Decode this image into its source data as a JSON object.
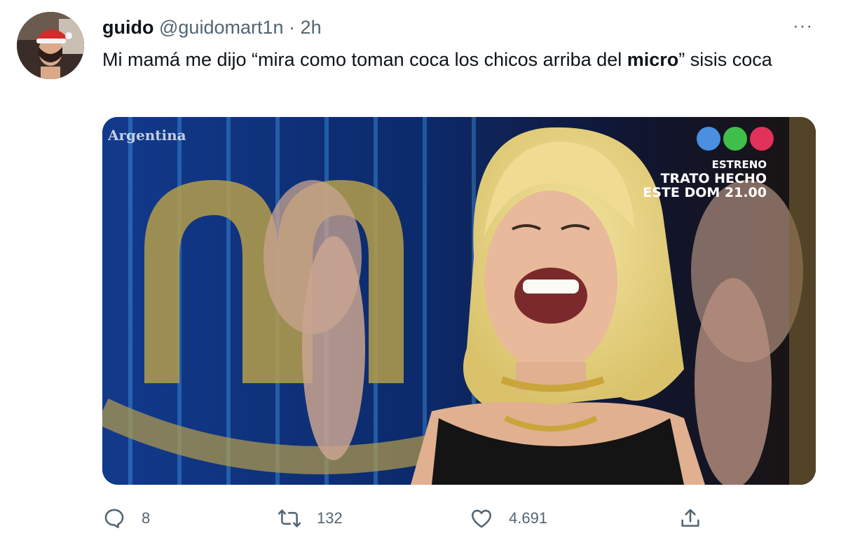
{
  "author": {
    "display_name": "guido",
    "handle": "@guidomart1n",
    "separator": "·",
    "time": "2h"
  },
  "more_label": "···",
  "tweet": {
    "text_before": "Mi mamá me dijo “mira como toman coca los chicos arriba del ",
    "text_bold": "micro",
    "text_after": "” sisis coca"
  },
  "media": {
    "corner_caption": "Argentina",
    "tv_promo": {
      "line1": "ESTRENO",
      "line2": "TRATO HECHO",
      "line3": "ESTE DOM 21.00"
    },
    "logo_colors": [
      "#4a8fe0",
      "#3fbf4a",
      "#e0325a"
    ]
  },
  "actions": {
    "reply": {
      "icon": "reply-icon",
      "count": "8"
    },
    "retweet": {
      "icon": "retweet-icon",
      "count": "132"
    },
    "like": {
      "icon": "heart-icon",
      "count": "4.691"
    },
    "share": {
      "icon": "share-icon"
    }
  },
  "colors": {
    "text_primary": "#0f1419",
    "text_secondary": "#536471"
  }
}
